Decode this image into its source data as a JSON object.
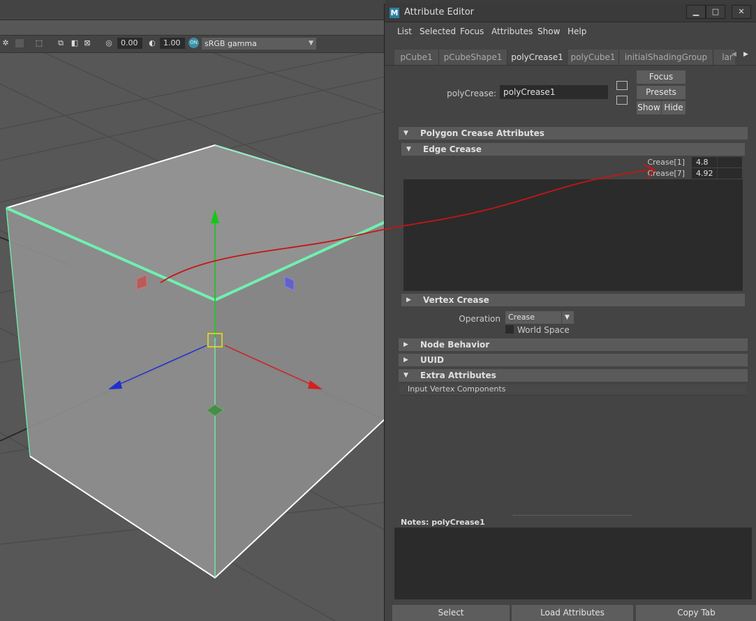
{
  "viewport": {
    "toolbar": {
      "exposure_value": "0.00",
      "gamma_value": "1.00",
      "color_management_icon": "color-management-toggle-icon",
      "color_management_text": "ON",
      "color_space": "sRGB gamma"
    },
    "manipulator": {
      "x_axis_color": "#d42020",
      "y_axis_color": "#14c814",
      "z_axis_color": "#1e2fd0",
      "center_handle_color": "#e6e600"
    },
    "selection_color": "#6ff0b0",
    "annotation_arrow_color": "#c81414"
  },
  "attribute_editor": {
    "title": "Attribute Editor",
    "logo_letter": "M",
    "window_buttons": [
      "minimize-icon",
      "maximize-icon",
      "close-icon"
    ],
    "menu": [
      "List",
      "Selected",
      "Focus",
      "Attributes",
      "Show",
      "Help"
    ],
    "tabs": [
      {
        "label": "pCube1"
      },
      {
        "label": "pCubeShape1"
      },
      {
        "label": "polyCrease1",
        "active": true
      },
      {
        "label": "polyCube1"
      },
      {
        "label": "initialShadingGroup"
      },
      {
        "label": "lar"
      }
    ],
    "node_label": "polyCrease:",
    "node_value": "polyCrease1",
    "buttons": {
      "focus": "Focus",
      "presets": "Presets",
      "show": "Show",
      "hide": "Hide"
    },
    "sections": {
      "polygon_crease": "Polygon Crease Attributes",
      "edge_crease": "Edge Crease",
      "vertex_crease": "Vertex Crease",
      "node_behavior": "Node Behavior",
      "uuid": "UUID",
      "extra_attributes": "Extra Attributes"
    },
    "edge_creases": [
      {
        "label": "Crease[1]",
        "value": "4.8"
      },
      {
        "label": "Crease[7]",
        "value": "4.92"
      }
    ],
    "operation_label": "Operation",
    "operation_value": "Crease",
    "world_space_label": "World Space",
    "world_space_checked": false,
    "input_vertex_components": "Input Vertex Components",
    "notes_label": "Notes:  polyCrease1",
    "notes_text": "",
    "footer": {
      "select": "Select",
      "load": "Load Attributes",
      "copy_tab": "Copy Tab"
    }
  }
}
